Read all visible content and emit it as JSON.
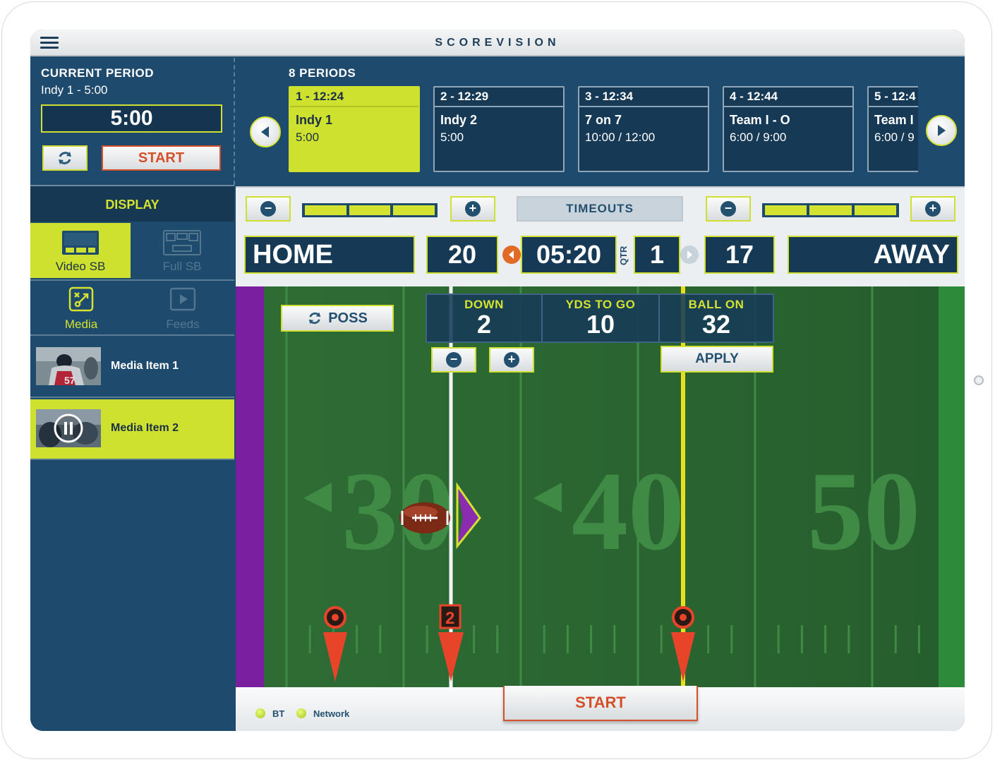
{
  "app": {
    "title": "SCOREVISION"
  },
  "current_period": {
    "label": "CURRENT PERIOD",
    "subtitle": "Indy 1 - 5:00",
    "time": "5:00",
    "start_label": "START"
  },
  "display": {
    "header": "DISPLAY",
    "tiles": [
      {
        "label": "Video SB",
        "active": true,
        "icon": "video-scoreboard-icon"
      },
      {
        "label": "Full SB",
        "active": false,
        "icon": "full-scoreboard-icon"
      }
    ],
    "media_tabs": [
      {
        "label": "Media",
        "active": true,
        "icon": "media-playbook-icon"
      },
      {
        "label": "Feeds",
        "active": false,
        "icon": "feeds-play-icon"
      }
    ],
    "media_items": [
      {
        "label": "Media Item 1",
        "selected": false
      },
      {
        "label": "Media Item 2",
        "selected": true,
        "state": "paused"
      }
    ]
  },
  "periods": {
    "label": "8 PERIODS",
    "items": [
      {
        "header": "1 - 12:24",
        "name": "Indy 1",
        "time": "5:00",
        "selected": true
      },
      {
        "header": "2 - 12:29",
        "name": "Indy 2",
        "time": "5:00",
        "selected": false
      },
      {
        "header": "3 - 12:34",
        "name": "7 on 7",
        "time": "10:00 / 12:00",
        "selected": false
      },
      {
        "header": "4 - 12:44",
        "name": "Team I - O",
        "time": "6:00 / 9:00",
        "selected": false
      },
      {
        "header": "5 - 12:4",
        "name": "Team I",
        "time": "6:00 / 9",
        "selected": false
      }
    ]
  },
  "scoreboard": {
    "timeouts_label": "TIMEOUTS",
    "home_timeouts": 3,
    "away_timeouts": 3,
    "home": {
      "name": "HOME",
      "score": "20"
    },
    "away": {
      "name": "AWAY",
      "score": "17"
    },
    "clock": "05:20",
    "qtr_label": "QTR",
    "quarter": "1",
    "possession": "home"
  },
  "field": {
    "poss_label": "POSS",
    "down_label": "DOWN",
    "down": "2",
    "ytg_label": "YDS TO GO",
    "ytg": "10",
    "ball_on_label": "BALL ON",
    "ball_on": "32",
    "apply_label": "APPLY",
    "yard_numbers": [
      "30",
      "40",
      "50"
    ],
    "down_marker": "2",
    "colors": {
      "grass": "#2b6a32",
      "endzone_left": "#7a1fa0",
      "first_down_line": "#e8e01c",
      "marker": "#e8442a"
    }
  },
  "status": {
    "indicators": [
      {
        "label": "BT",
        "on": true
      },
      {
        "label": "Network",
        "on": true
      }
    ],
    "start_label": "START"
  }
}
